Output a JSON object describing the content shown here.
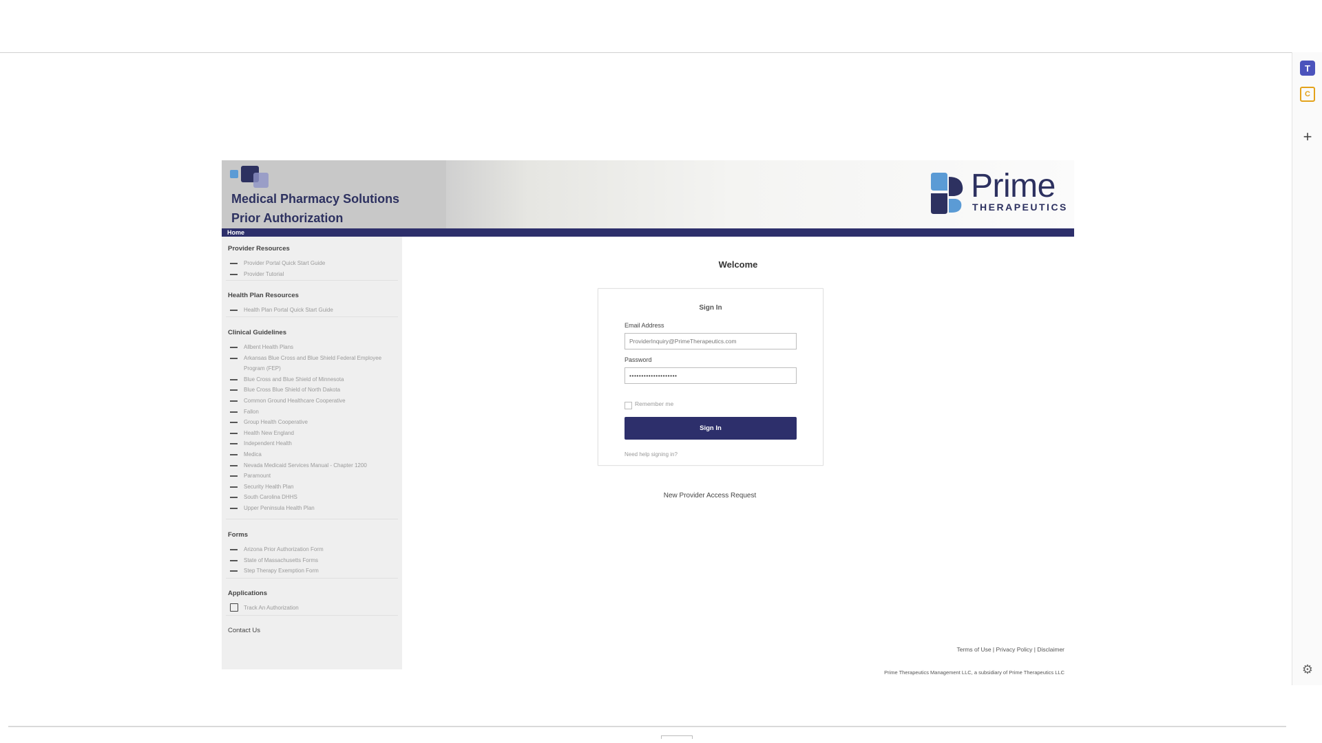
{
  "app": {
    "title_line1": "Medical Pharmacy Solutions",
    "title_line2": "Prior Authorization",
    "brand_name": "Prime",
    "brand_sub": "THERAPEUTICS",
    "nav_home": "Home"
  },
  "sidebar": {
    "provider_resources": {
      "heading": "Provider Resources",
      "items": [
        "Provider Portal Quick Start Guide",
        "Provider Tutorial"
      ]
    },
    "health_plan_resources": {
      "heading": "Health Plan Resources",
      "items": [
        "Health Plan Portal Quick Start Guide"
      ]
    },
    "clinical_guidelines": {
      "heading": "Clinical Guidelines",
      "items": [
        "Allbent Health Plans",
        "Arkansas Blue Cross and Blue Shield Federal Employee Program (FEP)",
        "Blue Cross and Blue Shield of Minnesota",
        "Blue Cross Blue Shield of North Dakota",
        "Common Ground Healthcare Cooperative",
        "Fallon",
        "Group Health Cooperative",
        "Health New England",
        "Independent Health",
        "Medica",
        "Nevada Medicaid Services Manual - Chapter 1200",
        "Paramount",
        "Security Health Plan",
        "South Carolina DHHS",
        "Upper Peninsula Health Plan"
      ]
    },
    "forms": {
      "heading": "Forms",
      "items": [
        "Arizona Prior Authorization Form",
        "State of Massachusetts Forms",
        "Step Therapy Exemption Form"
      ]
    },
    "applications": {
      "heading": "Applications",
      "items": [
        "Track An Authorization"
      ]
    },
    "contact_us": "Contact Us"
  },
  "main": {
    "welcome": "Welcome",
    "sign_in_title": "Sign In",
    "email_label": "Email Address",
    "email_value": "ProviderInquiry@PrimeTherapeutics.com",
    "password_label": "Password",
    "password_value": "••••••••••••••••••••",
    "remember_label": "Remember me",
    "sign_in_button": "Sign In",
    "need_help": "Need help signing in?",
    "new_provider": "New Provider Access Request",
    "footer_links": "Terms of Use | Privacy Policy | Disclaimer",
    "footer_copy": "Prime Therapeutics Management LLC, a subsidiary of Prime Therapeutics LLC"
  },
  "colors": {
    "navy": "#2d2f6b",
    "brand_blue": "#5b9bd5"
  },
  "icons": [
    "teams-icon",
    "calendar-icon",
    "plus-icon",
    "gear-icon",
    "external-link-icon"
  ]
}
